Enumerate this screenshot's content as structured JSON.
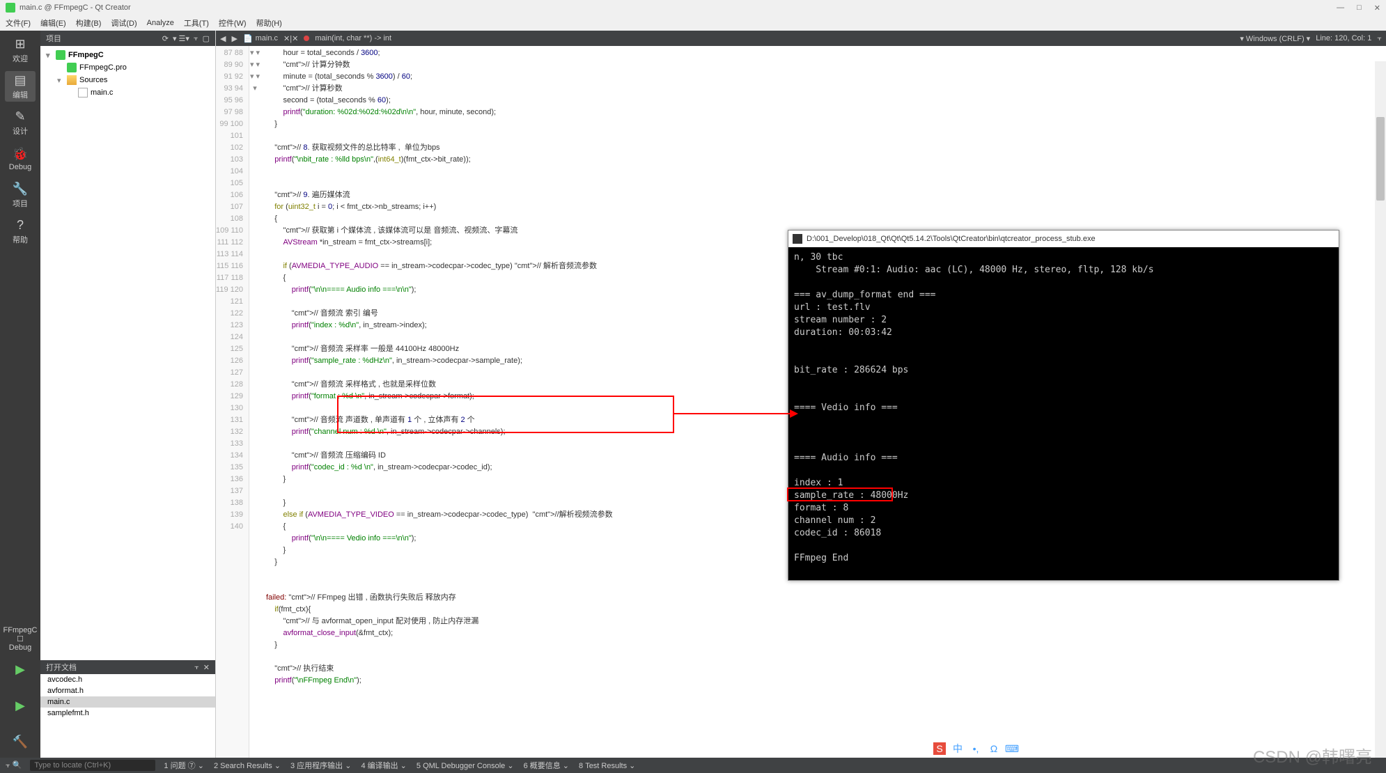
{
  "window": {
    "title": "main.c @ FFmpegC - Qt Creator"
  },
  "menu": [
    "文件(F)",
    "编辑(E)",
    "构建(B)",
    "调试(D)",
    "Analyze",
    "工具(T)",
    "控件(W)",
    "帮助(H)"
  ],
  "leftToolbar": {
    "items": [
      {
        "icon": "⊞",
        "label": "欢迎"
      },
      {
        "icon": "▤",
        "label": "编辑",
        "active": true
      },
      {
        "icon": "✎",
        "label": "设计"
      },
      {
        "icon": "🐞",
        "label": "Debug"
      },
      {
        "icon": "🔧",
        "label": "项目"
      },
      {
        "icon": "?",
        "label": "帮助"
      }
    ],
    "config": "FFmpegC",
    "buildType": "Debug"
  },
  "projectPanel": {
    "title": "项目"
  },
  "tree": [
    {
      "indent": 0,
      "arrow": "▾",
      "icon": "qt",
      "label": "FFmpegC",
      "bold": true
    },
    {
      "indent": 1,
      "arrow": "",
      "icon": "qt",
      "label": "FFmpegC.pro"
    },
    {
      "indent": 1,
      "arrow": "▾",
      "icon": "folder",
      "label": "Sources"
    },
    {
      "indent": 2,
      "arrow": "",
      "icon": "file",
      "label": "main.c"
    }
  ],
  "openDocs": {
    "title": "打开文档",
    "items": [
      "avcodec.h",
      "avformat.h",
      "main.c",
      "samplefmt.h"
    ],
    "selected": "main.c"
  },
  "editor": {
    "file": "main.c",
    "breadcrumb": "main(int, char **) -> int",
    "encoding": "Windows (CRLF)",
    "position": "Line: 120, Col: 1",
    "startLine": 87,
    "lines": [
      "        hour = total_seconds / 3600;",
      "        // 计算分钟数",
      "        minute = (total_seconds % 3600) / 60;",
      "        // 计算秒数",
      "        second = (total_seconds % 60);",
      "        printf(\"duration: %02d:%02d:%02d\\n\\n\", hour, minute, second);",
      "    }",
      "",
      "    // 8. 获取视频文件的总比特率 ,  单位为bps",
      "    printf(\"\\nbit_rate : %lld bps\\n\",(int64_t)(fmt_ctx->bit_rate));",
      "",
      "",
      "    // 9. 遍历媒体流",
      "    for (uint32_t i = 0; i < fmt_ctx->nb_streams; i++)",
      "    {",
      "        // 获取第 i 个媒体流 , 该媒体流可以是 音频流、视频流、字幕流",
      "        AVStream *in_stream = fmt_ctx->streams[i];",
      "",
      "        if (AVMEDIA_TYPE_AUDIO == in_stream->codecpar->codec_type) // 解析音频流参数",
      "        {",
      "            printf(\"\\n\\n==== Audio info ===\\n\\n\");",
      "",
      "            // 音频流 索引 编号",
      "            printf(\"index : %d\\n\", in_stream->index);",
      "",
      "            // 音频流 采样率 一般是 44100Hz 48000Hz",
      "            printf(\"sample_rate : %dHz\\n\", in_stream->codecpar->sample_rate);",
      "",
      "            // 音频流 采样格式 , 也就是采样位数",
      "            printf(\"format : %d \\n\", in_stream->codecpar->format);",
      "",
      "            // 音频流 声道数 , 单声道有 1 个 , 立体声有 2 个",
      "            printf(\"channel num : %d \\n\", in_stream->codecpar->channels);",
      "",
      "            // 音频流 压缩编码 ID",
      "            printf(\"codec_id : %d \\n\", in_stream->codecpar->codec_id);",
      "        }",
      "",
      "        }",
      "        else if (AVMEDIA_TYPE_VIDEO == in_stream->codecpar->codec_type)  //解析视频流参数",
      "        {",
      "            printf(\"\\n\\n==== Vedio info ===\\n\\n\");",
      "        }",
      "    }",
      "",
      "",
      "failed: // FFmpeg 出错 , 函数执行失败后 释放内存",
      "    if(fmt_ctx){",
      "        // 与 avformat_open_input 配对使用 , 防止内存泄漏",
      "        avformat_close_input(&fmt_ctx);",
      "    }",
      "",
      "    // 执行结束",
      "    printf(\"\\nFFmpeg End\\n\");"
    ]
  },
  "console": {
    "title": "D:\\001_Develop\\018_Qt\\Qt\\Qt5.14.2\\Tools\\QtCreator\\bin\\qtcreator_process_stub.exe",
    "lines": [
      "n, 30 tbc",
      "    Stream #0:1: Audio: aac (LC), 48000 Hz, stereo, fltp, 128 kb/s",
      "",
      "=== av_dump_format end ===",
      "url : test.flv",
      "stream number : 2",
      "duration: 00:03:42",
      "",
      "",
      "bit_rate : 286624 bps",
      "",
      "",
      "==== Vedio info ===",
      "",
      "",
      "",
      "==== Audio info ===",
      "",
      "index : 1",
      "sample_rate : 48000Hz",
      "format : 8",
      "channel num : 2",
      "codec_id : 86018",
      "",
      "FFmpeg End"
    ]
  },
  "statusbar": {
    "searchPlaceholder": "Type to locate (Ctrl+K)",
    "items": [
      "1 问题 ⑦",
      "2 Search Results",
      "3 应用程序输出",
      "4 编译输出",
      "5 QML Debugger Console",
      "6 概要信息",
      "8 Test Results"
    ]
  },
  "watermark": "CSDN @韩曙亮"
}
